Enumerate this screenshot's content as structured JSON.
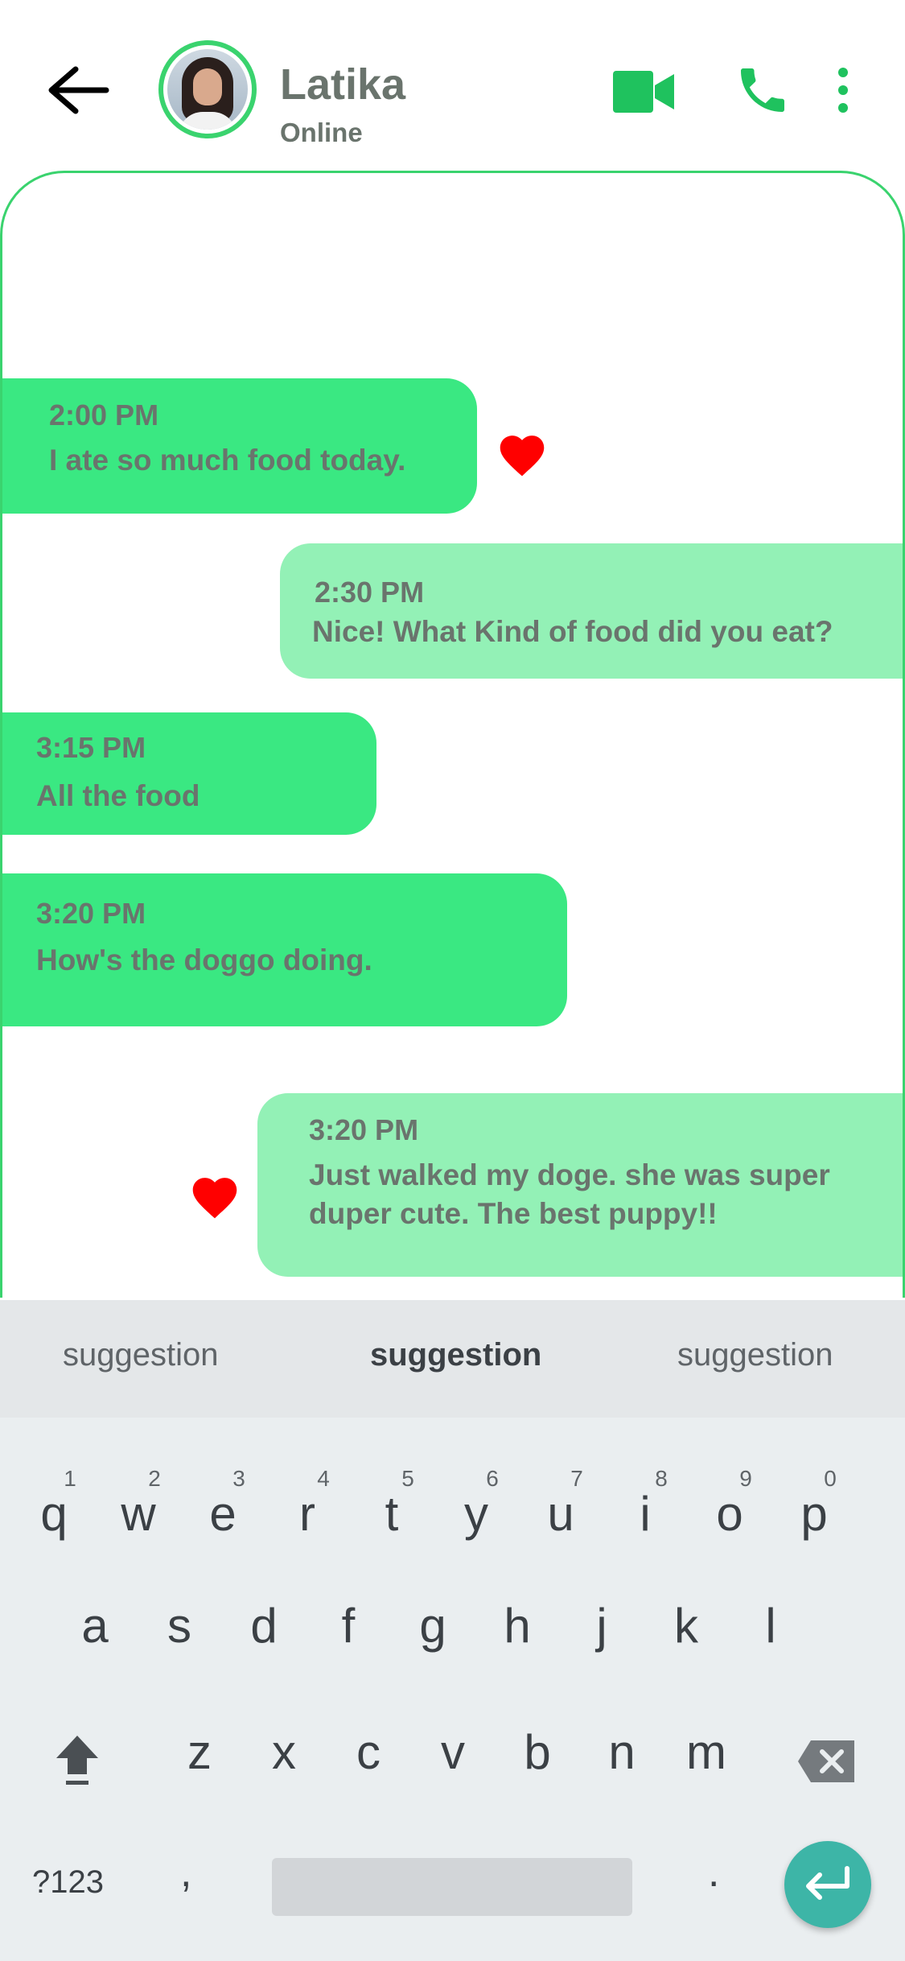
{
  "header": {
    "contact_name": "Latika",
    "contact_status": "Online"
  },
  "messages": [
    {
      "direction": "in",
      "time": "2:00 PM",
      "text": "I ate so much food today.",
      "liked": true
    },
    {
      "direction": "out",
      "time": "2:30 PM",
      "text": "Nice! What Kind of food did you eat?",
      "liked": false
    },
    {
      "direction": "in",
      "time": "3:15 PM",
      "text": "All the food",
      "liked": false
    },
    {
      "direction": "in",
      "time": "3:20 PM",
      "text": "How's the doggo doing.",
      "liked": false
    },
    {
      "direction": "out",
      "time": "3:20 PM",
      "text": "Just walked my doge. she was super duper cute. The best puppy!!",
      "liked": true
    }
  ],
  "keyboard": {
    "suggestions": [
      "suggestion",
      "suggestion",
      "suggestion"
    ],
    "row1": [
      "q",
      "w",
      "e",
      "r",
      "t",
      "y",
      "u",
      "i",
      "o",
      "p"
    ],
    "row1_numbers": [
      "1",
      "2",
      "3",
      "4",
      "5",
      "6",
      "7",
      "8",
      "9",
      "0"
    ],
    "row2": [
      "a",
      "s",
      "d",
      "f",
      "g",
      "h",
      "j",
      "k",
      "l"
    ],
    "row3": [
      "z",
      "x",
      "c",
      "v",
      "b",
      "n",
      "m"
    ],
    "symbols_label": "?123",
    "comma": ",",
    "period": "."
  },
  "colors": {
    "accent_green": "#3ad36e",
    "incoming_bubble": "#3ae882",
    "outgoing_bubble": "#93f1b6",
    "heart": "#ff0000",
    "enter_key": "#3db5a7"
  },
  "icons": {
    "back": "arrow-left-icon",
    "video": "video-camera-icon",
    "call": "phone-icon",
    "more": "more-vertical-icon",
    "like": "heart-icon",
    "shift": "shift-icon",
    "backspace": "backspace-icon",
    "enter": "enter-icon"
  }
}
